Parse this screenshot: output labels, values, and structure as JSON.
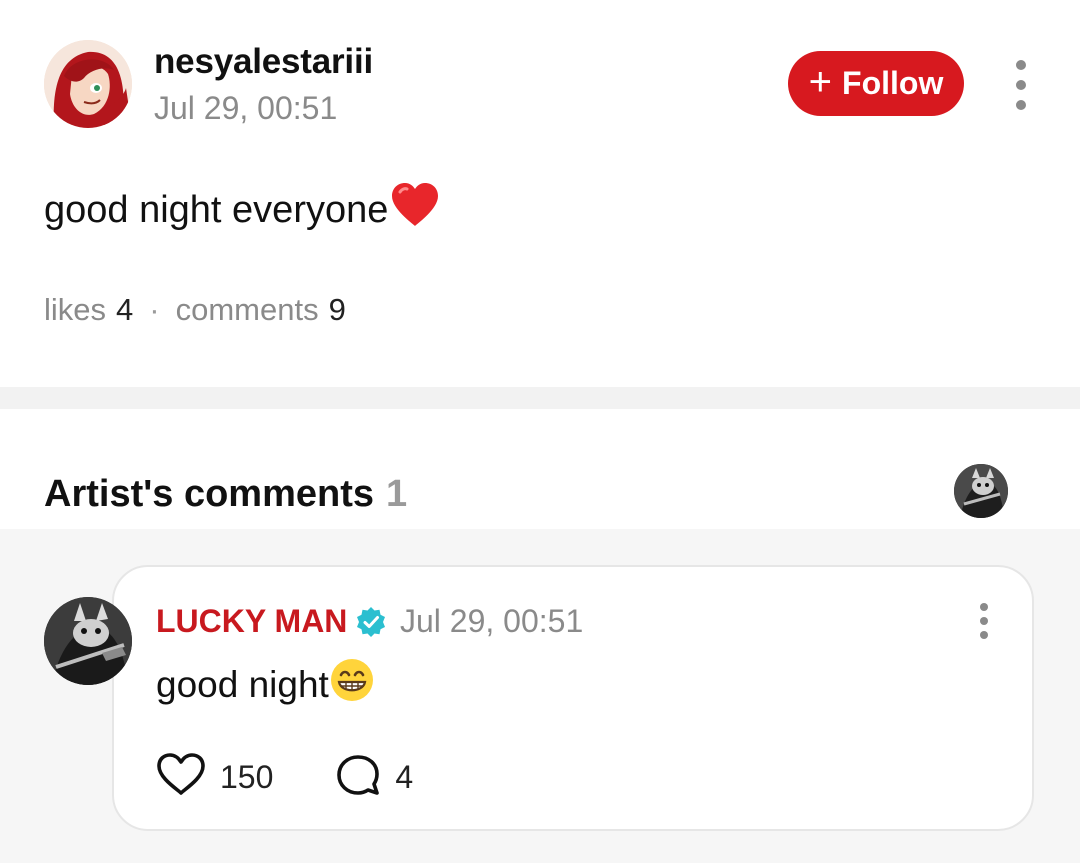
{
  "post": {
    "username": "nesyalestariii",
    "timestamp": "Jul 29, 00:51",
    "follow_label": "Follow",
    "text": "good night everyone",
    "text_emoji": "red-heart",
    "likes_label": "likes",
    "likes_count": "4",
    "comments_label": "comments",
    "comments_count": "9"
  },
  "artist_section": {
    "title": "Artist's comments",
    "count": "1"
  },
  "comment": {
    "author": "LUCKY MAN",
    "verified": true,
    "timestamp": "Jul 29, 00:51",
    "text": "good night",
    "text_emoji": "grinning-face",
    "likes": "150",
    "replies": "4"
  },
  "colors": {
    "accent": "#d7191f",
    "author_red": "#c8191f",
    "verified_teal": "#2bbfd0",
    "muted_text": "#8a8a8a"
  },
  "icons": [
    "more-vertical-icon",
    "plus-icon",
    "heart-outline-icon",
    "comment-bubble-icon",
    "verified-badge-icon"
  ]
}
